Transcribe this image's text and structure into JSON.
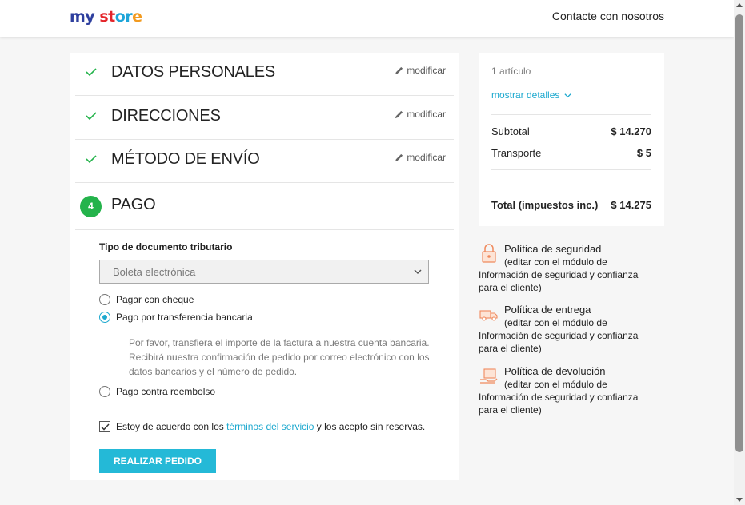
{
  "header": {
    "logo": {
      "w1": "my",
      "w2": "st",
      "w3": "or",
      "w4": "e"
    },
    "contact_link": "Contacte con nosotros"
  },
  "steps": [
    {
      "title": "DATOS PERSONALES",
      "edit_label": "modificar"
    },
    {
      "title": "DIRECCIONES",
      "edit_label": "modificar"
    },
    {
      "title": "MÉTODO DE ENVÍO",
      "edit_label": "modificar"
    },
    {
      "number": "4",
      "title": "PAGO"
    }
  ],
  "payment": {
    "doc_type_label": "Tipo de documento tributario",
    "doc_type_selected": "Boleta electrónica",
    "options": [
      {
        "label": "Pagar con cheque",
        "selected": false
      },
      {
        "label": "Pago por transferencia bancaria",
        "selected": true
      },
      {
        "label": "Pago contra reembolso",
        "selected": false
      }
    ],
    "transfer_info": "Por favor, transfiera el importe de la factura a nuestra cuenta bancaria. Recibirá nuestra confirmación de pedido por correo electrónico con los datos bancarios y el número de pedido.",
    "terms_prefix": "Estoy de acuerdo con los ",
    "terms_link": "términos del servicio",
    "terms_suffix": " y los acepto sin reservas.",
    "submit_label": "REALIZAR PEDIDO"
  },
  "cart": {
    "items_count": "1 artículo",
    "show_details": "mostrar detalles",
    "subtotal_label": "Subtotal",
    "subtotal_value": "$ 14.270",
    "shipping_label": "Transporte",
    "shipping_value": "$ 5",
    "total_label": "Total (impuestos inc.)",
    "total_value": "$ 14.275"
  },
  "reassurance": [
    {
      "icon": "lock-icon",
      "title": "Política de seguridad",
      "line1": "(editar con el módulo de",
      "rest": "Información de seguridad y confianza para el cliente)"
    },
    {
      "icon": "truck-icon",
      "title": "Política de entrega",
      "line1": "(editar con el módulo de",
      "rest": "Información de seguridad y confianza para el cliente)"
    },
    {
      "icon": "return-box-icon",
      "title": "Política de devolución",
      "line1": "(editar con el módulo de",
      "rest": "Información de seguridad y confianza para el cliente)"
    }
  ],
  "colors": {
    "accent": "#24b9d7",
    "success": "#24b34b",
    "link": "#1da9cf"
  }
}
